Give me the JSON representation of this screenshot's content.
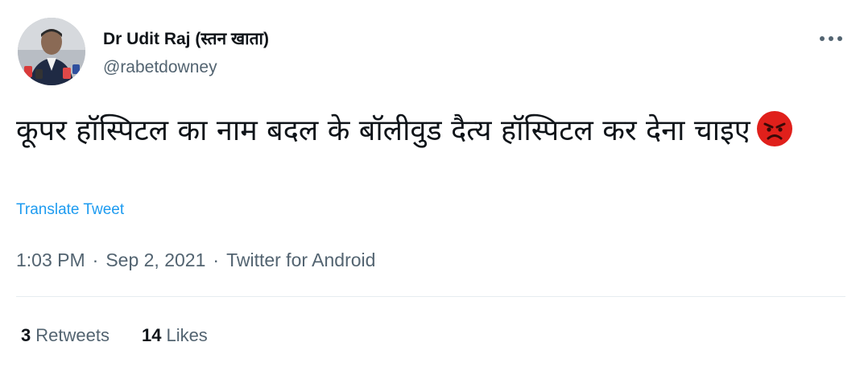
{
  "author": {
    "display_name": "Dr Udit Raj (स्तन खाता)",
    "handle": "@rabetdowney"
  },
  "tweet": {
    "text": "कूपर हॉस्पिटल का नाम बदल के बॉलीवुड दैत्य हॉस्पिटल कर देना चाइए",
    "emoji": "angry-face-emoji",
    "translate_label": "Translate Tweet",
    "time": "1:03 PM",
    "date": "Sep 2, 2021",
    "source": "Twitter for Android",
    "separator": "·"
  },
  "stats": {
    "retweets_count": "3",
    "retweets_label": "Retweets",
    "likes_count": "14",
    "likes_label": "Likes"
  },
  "icons": {
    "more": "more-horizontal-icon"
  },
  "colors": {
    "link": "#1d9bf0",
    "secondary_text": "#536471",
    "primary_text": "#0f1419",
    "emoji_red": "#e0201b"
  }
}
